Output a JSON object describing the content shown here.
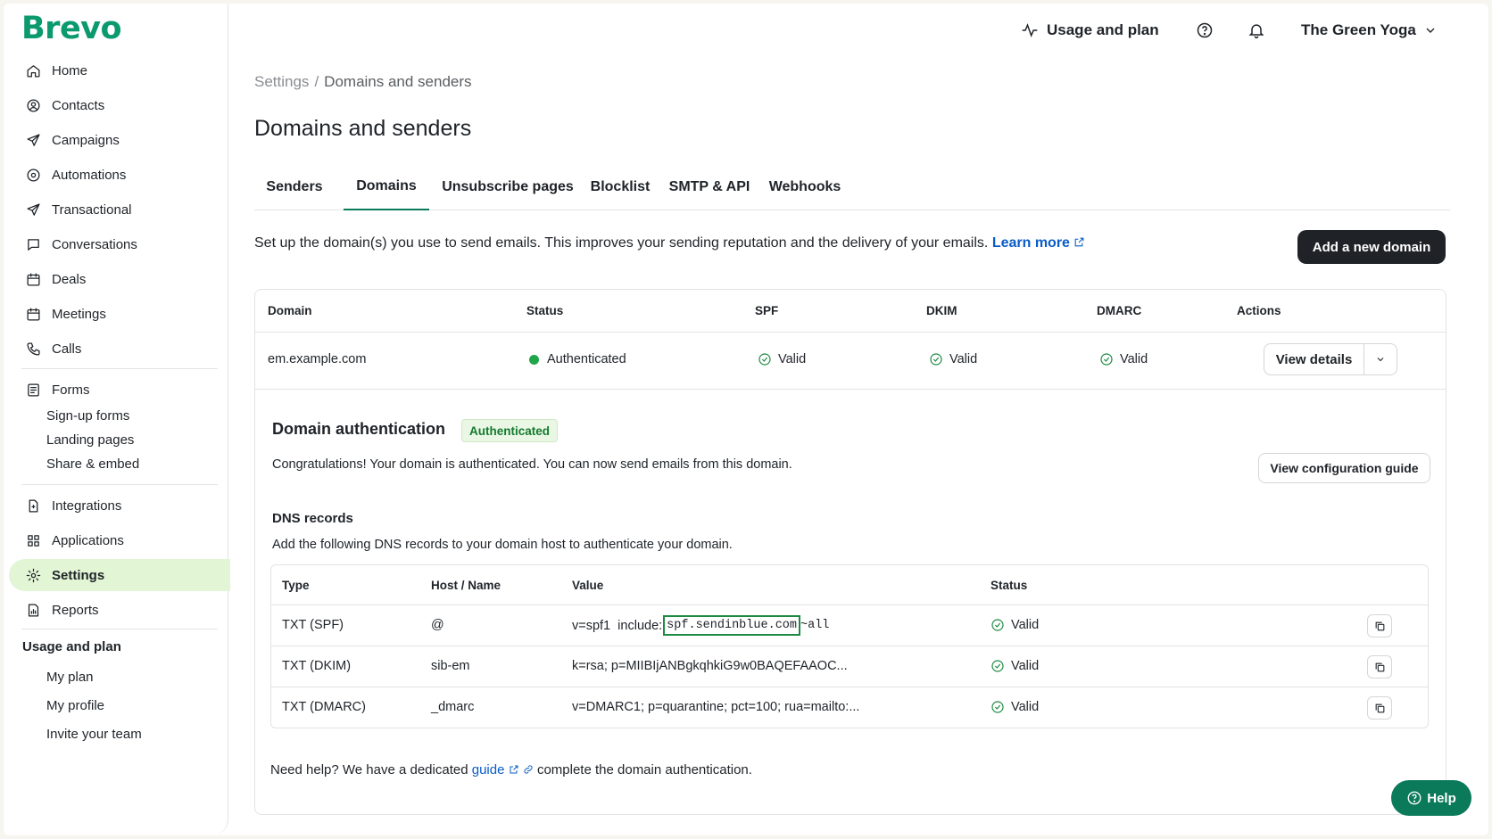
{
  "brand": "Brevo",
  "colors": {
    "brand_green": "#0b996e",
    "active_nav_bg": "#e2f5d5",
    "primary_button": "#1f2328",
    "link": "#0b5cc7",
    "valid_green": "#1d8a42"
  },
  "sidebar": {
    "items": [
      {
        "label": "Home",
        "icon": "home-icon"
      },
      {
        "label": "Contacts",
        "icon": "contacts-icon"
      },
      {
        "label": "Campaigns",
        "icon": "send-icon"
      },
      {
        "label": "Automations",
        "icon": "automation-icon"
      },
      {
        "label": "Transactional",
        "icon": "send-icon"
      },
      {
        "label": "Conversations",
        "icon": "chat-icon"
      },
      {
        "label": "Deals",
        "icon": "briefcase-icon"
      },
      {
        "label": "Meetings",
        "icon": "calendar-icon"
      },
      {
        "label": "Calls",
        "icon": "phone-icon"
      },
      {
        "label": "Forms",
        "icon": "form-icon"
      },
      {
        "label": "Integrations",
        "icon": "integration-icon"
      },
      {
        "label": "Applications",
        "icon": "grid-icon"
      },
      {
        "label": "Settings",
        "icon": "gear-icon",
        "active": true
      },
      {
        "label": "Reports",
        "icon": "report-icon"
      }
    ],
    "forms_sub": [
      "Sign-up forms",
      "Landing pages",
      "Share & embed"
    ],
    "usage_group": {
      "title": "Usage and plan",
      "items": [
        "My plan",
        "My profile",
        "Invite your team"
      ]
    }
  },
  "topbar": {
    "usage": "Usage and plan",
    "account": "The Green Yoga"
  },
  "breadcrumb": {
    "parent": "Settings",
    "sep": "/",
    "current": "Domains and senders"
  },
  "page_title": "Domains and senders",
  "tabs": [
    {
      "label": "Senders"
    },
    {
      "label": "Domains",
      "active": true
    },
    {
      "label": "Unsubscribe pages"
    },
    {
      "label": "Blocklist"
    },
    {
      "label": "SMTP & API"
    },
    {
      "label": "Webhooks"
    }
  ],
  "intro": {
    "text": "Set up the domain(s) you use to send emails. This improves your sending reputation and the delivery of your emails.",
    "link": "Learn more"
  },
  "add_domain_button": "Add a new domain",
  "domains_table": {
    "columns": [
      "Domain",
      "Status",
      "SPF",
      "DKIM",
      "DMARC",
      "Actions"
    ],
    "row": {
      "domain": "em.example.com",
      "status": "Authenticated",
      "spf": "Valid",
      "dkim": "Valid",
      "dmarc": "Valid",
      "action": "View details"
    }
  },
  "auth": {
    "title": "Domain authentication",
    "badge": "Authenticated",
    "message": "Congratulations! Your domain is authenticated. You can now send emails from this domain.",
    "guide_button": "View configuration guide"
  },
  "dns": {
    "title": "DNS records",
    "description": "Add the following DNS records to your domain host to authenticate your domain.",
    "columns": [
      "Type",
      "Host / Name",
      "Value",
      "Status"
    ],
    "rows": [
      {
        "type": "TXT (SPF)",
        "host": "@",
        "value_pre": "v=spf1  include:",
        "value_hl": "spf.sendinblue.com",
        "value_post": "~all",
        "status": "Valid"
      },
      {
        "type": "TXT (DKIM)",
        "host": "sib-em",
        "value": "k=rsa; p=MIIBIjANBgkqhkiG9w0BAQEFAAOC...",
        "status": "Valid"
      },
      {
        "type": "TXT (DMARC)",
        "host": "_dmarc",
        "value": "v=DMARC1; p=quarantine; pct=100; rua=mailto:...",
        "status": "Valid"
      }
    ]
  },
  "help": {
    "pre": "Need help? We have a dedicated",
    "link": "guide",
    "post": "complete the domain authentication."
  },
  "help_fab": "Help"
}
